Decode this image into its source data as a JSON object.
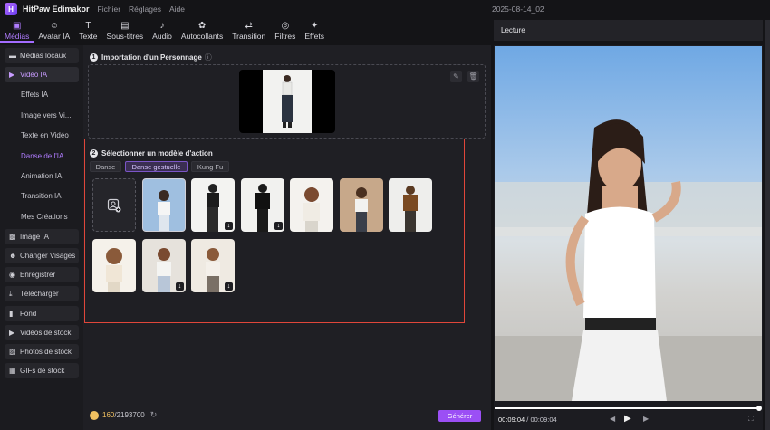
{
  "app": {
    "name": "HitPaw Edimakor",
    "menu": [
      "Fichier",
      "Réglages",
      "Aide"
    ],
    "project_title": "2025-08-14_02"
  },
  "toolbar": {
    "tools": [
      {
        "label": "Médias",
        "icon": "media-icon",
        "glyph": "▣"
      },
      {
        "label": "Avatar IA",
        "icon": "avatar-ai-icon",
        "glyph": "☺"
      },
      {
        "label": "Texte",
        "icon": "text-icon",
        "glyph": "T"
      },
      {
        "label": "Sous-titres",
        "icon": "subtitles-icon",
        "glyph": "▤"
      },
      {
        "label": "Audio",
        "icon": "audio-icon",
        "glyph": "♪"
      },
      {
        "label": "Autocollants",
        "icon": "stickers-icon",
        "glyph": "✿"
      },
      {
        "label": "Transition",
        "icon": "transition-icon",
        "glyph": "⇄"
      },
      {
        "label": "Filtres",
        "icon": "filters-icon",
        "glyph": "◎"
      },
      {
        "label": "Effets",
        "icon": "effects-icon",
        "glyph": "✦"
      }
    ]
  },
  "sidebar": {
    "items": [
      {
        "label": "Médias locaux",
        "glyph": "▬"
      },
      {
        "label": "Vidéo IA",
        "glyph": "▶"
      },
      {
        "label": "Image IA",
        "glyph": "▩"
      },
      {
        "label": "Changer Visages",
        "glyph": "☻"
      },
      {
        "label": "Enregistrer",
        "glyph": "◉"
      },
      {
        "label": "Télécharger",
        "glyph": "⤓"
      },
      {
        "label": "Fond",
        "glyph": "▮"
      },
      {
        "label": "Vidéos de stock",
        "glyph": "▶"
      },
      {
        "label": "Photos de stock",
        "glyph": "▨"
      },
      {
        "label": "GIFs de stock",
        "glyph": "▦"
      }
    ],
    "sub_items": [
      "Effets IA",
      "Image vers Vi...",
      "Texte en Vidéo",
      "Danse de l'IA",
      "Animation IA",
      "Transition IA",
      "Mes Créations"
    ]
  },
  "import_section": {
    "number": "1",
    "title": "Importation d'un Personnage",
    "info_icon": "ⓘ"
  },
  "action_section": {
    "number": "2",
    "title": "Sélectionner un modèle d'action",
    "tabs": [
      "Danse",
      "Danse gestuelle",
      "Kung Fu"
    ]
  },
  "bottom": {
    "credits_used": "160",
    "credits_total": "/2193700",
    "generate_label": "Générer"
  },
  "player": {
    "header": "Lecture",
    "current_time": "00:09:04",
    "total_time": "00:09:04",
    "separator": " / "
  },
  "colors": {
    "accent": "#a36cff",
    "generate": "#9b4ff5",
    "highlight_border": "#e0463a"
  }
}
